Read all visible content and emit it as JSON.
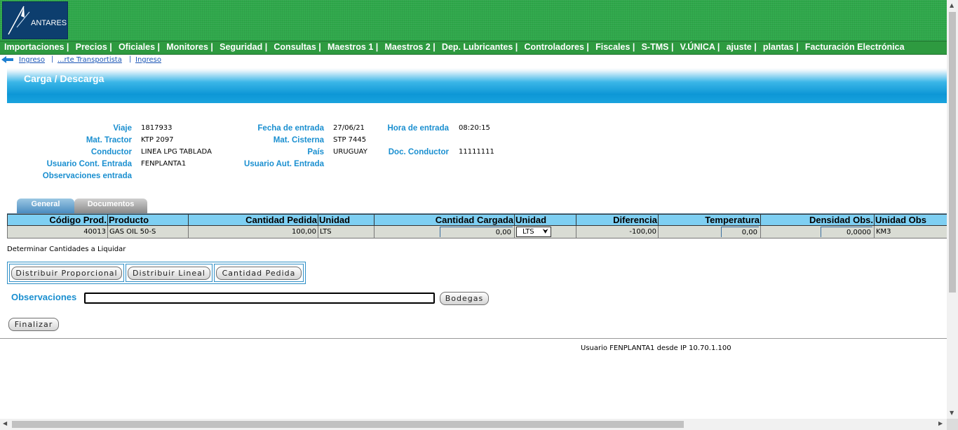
{
  "logo": {
    "text": "ANTARES"
  },
  "menu": [
    "Importaciones |",
    "Precios |",
    "Oficiales |",
    "Monitores |",
    "Seguridad |",
    "Consultas |",
    "Maestros 1 |",
    "Maestros 2 |",
    "Dep. Lubricantes |",
    "Controladores |",
    "Fiscales |",
    "S-TMS |",
    "V.ÚNICA |",
    "ajuste |",
    "plantas |",
    "Facturación Electrónica"
  ],
  "breadcrumb": {
    "items": [
      "Ingreso",
      "...rte Transportista",
      "Ingreso"
    ],
    "separator": "|",
    "back_icon": "back-arrow-icon"
  },
  "page_title": "Carga / Descarga",
  "info": {
    "viaje": {
      "label": "Viaje",
      "value": "1817933"
    },
    "mat_tractor": {
      "label": "Mat. Tractor",
      "value": "KTP 2097"
    },
    "conductor": {
      "label": "Conductor",
      "value": "LINEA LPG TABLADA"
    },
    "usuario_cont": {
      "label": "Usuario Cont. Entrada",
      "value": "FENPLANTA1"
    },
    "observaciones_entrada": {
      "label": "Observaciones entrada",
      "value": ""
    },
    "fecha_entrada": {
      "label": "Fecha de entrada",
      "value": "27/06/21"
    },
    "mat_cisterna": {
      "label": "Mat. Cisterna",
      "value": "STP 7445"
    },
    "pais": {
      "label": "País",
      "value": "URUGUAY"
    },
    "usuario_aut": {
      "label": "Usuario Aut. Entrada",
      "value": ""
    },
    "hora_entrada": {
      "label": "Hora de entrada",
      "value": "08:20:15"
    },
    "doc_conductor": {
      "label": "Doc. Conductor",
      "value": "11111111"
    }
  },
  "tabs": [
    "General",
    "Documentos"
  ],
  "table": {
    "headers": [
      "Código Prod.",
      "Producto",
      "Cantidad Pedida",
      "Unidad",
      "Cantidad Cargada",
      "Unidad",
      "Diferencia",
      "Temperatura",
      "Densidad Obs.",
      "Unidad Obs"
    ],
    "row": {
      "codigo": "40013",
      "producto": "GAS OIL 50-S",
      "cantidad_pedida": "100,00",
      "unidad": "LTS",
      "cantidad_cargada": "0,00",
      "unidad_select": "LTS",
      "diferencia": "-100,00",
      "temperatura": "0,00",
      "densidad": "0,0000",
      "unidad_obs": "KM3"
    }
  },
  "determinar_label": "Determinar Cantidades a Liquidar",
  "buttons": {
    "proporcional": "Distribuir Proporcional",
    "lineal": "Distribuir Lineal",
    "cantidad_pedida": "Cantidad Pedida",
    "bodegas": "Bodegas",
    "finalizar": "Finalizar"
  },
  "observaciones": {
    "label": "Observaciones",
    "value": ""
  },
  "footer": "Usuario FENPLANTA1 desde IP 10.70.1.100",
  "colors": {
    "header_green": "#2ea84a",
    "accent_blue": "#1a8fd0",
    "table_header": "#7ecff2",
    "banner_blue": "#0d97d6"
  }
}
